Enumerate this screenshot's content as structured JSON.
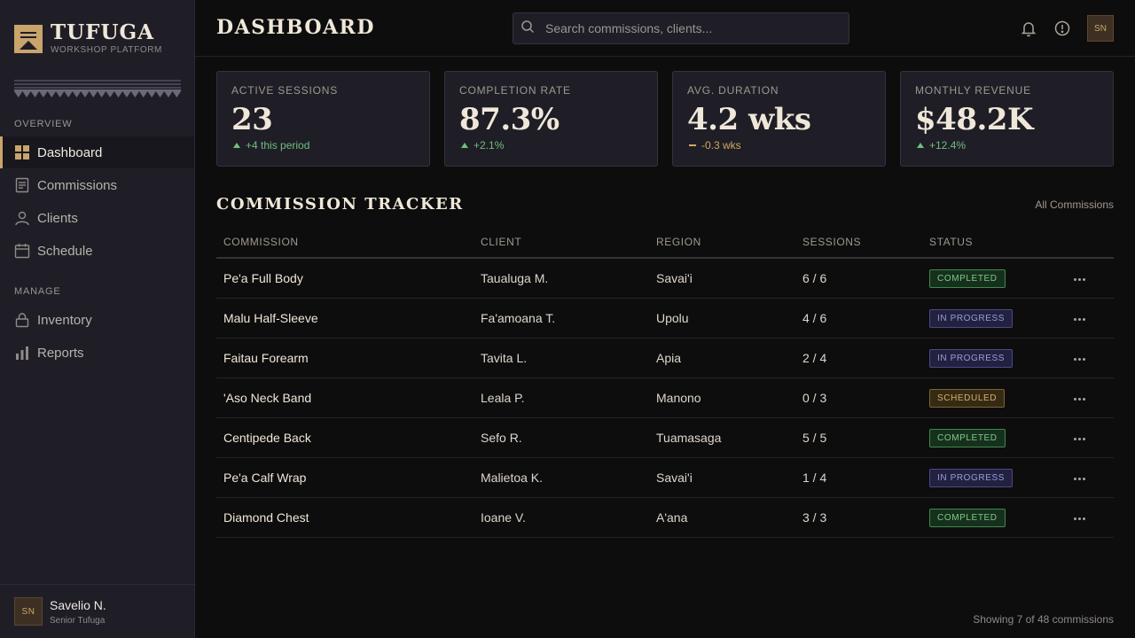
{
  "brand": {
    "title": "TUFUGA",
    "subtitle": "WORKSHOP PLATFORM"
  },
  "sidebar": {
    "sections": [
      {
        "label": "OVERVIEW"
      },
      {
        "label": "MANAGE"
      }
    ],
    "items": [
      {
        "label": "Dashboard",
        "icon": "grid-icon",
        "active": true
      },
      {
        "label": "Commissions",
        "icon": "document-icon"
      },
      {
        "label": "Clients",
        "icon": "user-icon"
      },
      {
        "label": "Schedule",
        "icon": "calendar-icon"
      },
      {
        "label": "Inventory",
        "icon": "lock-icon"
      },
      {
        "label": "Reports",
        "icon": "bar-chart-icon"
      }
    ],
    "user": {
      "initials": "SN",
      "name": "Savelio N.",
      "role": "Senior Tufuga"
    }
  },
  "header": {
    "title": "DASHBOARD",
    "search_placeholder": "Search commissions, clients...",
    "avatar_initials": "SN"
  },
  "stats": [
    {
      "label": "ACTIVE SESSIONS",
      "value": "23",
      "delta": "+4 this period",
      "trend": "up"
    },
    {
      "label": "COMPLETION RATE",
      "value": "87.3%",
      "delta": "+2.1%",
      "trend": "up"
    },
    {
      "label": "AVG. DURATION",
      "value": "4.2 wks",
      "delta": "-0.3 wks",
      "trend": "neutral"
    },
    {
      "label": "MONTHLY REVENUE",
      "value": "$48.2K",
      "delta": "+12.4%",
      "trend": "up"
    }
  ],
  "tracker": {
    "title": "COMMISSION TRACKER",
    "all_link": "All Commissions",
    "columns": [
      "COMMISSION",
      "CLIENT",
      "REGION",
      "SESSIONS",
      "STATUS"
    ],
    "rows": [
      {
        "commission": "Pe'a Full Body",
        "client": "Taualuga M.",
        "region": "Savai'i",
        "sessions": "6 / 6",
        "status": "COMPLETED"
      },
      {
        "commission": "Malu Half-Sleeve",
        "client": "Fa'amoana T.",
        "region": "Upolu",
        "sessions": "4 / 6",
        "status": "IN PROGRESS"
      },
      {
        "commission": "Faitau Forearm",
        "client": "Tavita L.",
        "region": "Apia",
        "sessions": "2 / 4",
        "status": "IN PROGRESS"
      },
      {
        "commission": "'Aso Neck Band",
        "client": "Leala P.",
        "region": "Manono",
        "sessions": "0 / 3",
        "status": "SCHEDULED"
      },
      {
        "commission": "Centipede Back",
        "client": "Sefo R.",
        "region": "Tuamasaga",
        "sessions": "5 / 5",
        "status": "COMPLETED"
      },
      {
        "commission": "Pe'a Calf Wrap",
        "client": "Malietoa K.",
        "region": "Savai'i",
        "sessions": "1 / 4",
        "status": "IN PROGRESS"
      },
      {
        "commission": "Diamond Chest",
        "client": "Ioane V.",
        "region": "A'ana",
        "sessions": "3 / 3",
        "status": "COMPLETED"
      }
    ],
    "footer": "Showing 7 of 48 commissions"
  },
  "colors": {
    "accent": "#c9a46b",
    "completed": "#7ccc8a",
    "in_progress": "#9c9ce0",
    "scheduled": "#d7b06a"
  }
}
